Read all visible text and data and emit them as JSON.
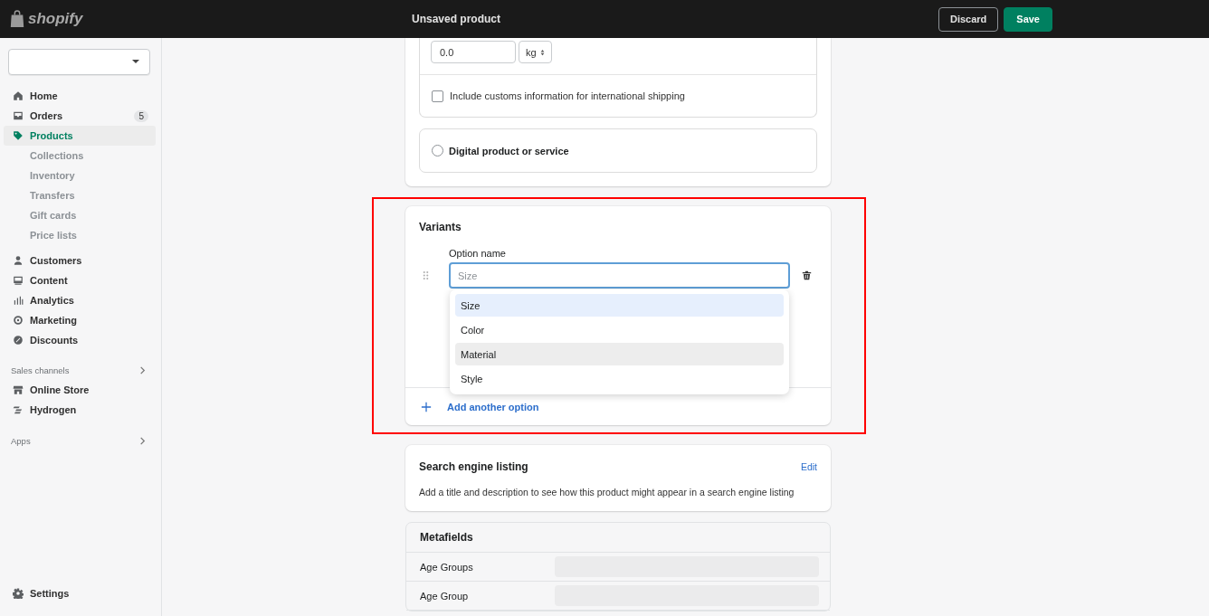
{
  "header": {
    "logo_text": "shopify",
    "title": "Unsaved product",
    "buttons": [
      {
        "label": "Discard",
        "kind": "secondary"
      },
      {
        "label": "Save",
        "kind": "primary"
      }
    ]
  },
  "sidebar": {
    "nav": [
      {
        "label": "Home",
        "selected": false
      },
      {
        "label": "Orders",
        "selected": false,
        "badge": "5"
      },
      {
        "label": "Products",
        "selected": true,
        "children": [
          {
            "label": "Collections",
            "selected": false
          },
          {
            "label": "Inventory",
            "selected": false
          },
          {
            "label": "Transfers",
            "selected": false
          },
          {
            "label": "Gift cards",
            "selected": false
          },
          {
            "label": "Price lists",
            "selected": false
          }
        ]
      },
      {
        "label": "Customers",
        "selected": false
      },
      {
        "label": "Content",
        "selected": false
      },
      {
        "label": "Analytics",
        "selected": false
      },
      {
        "label": "Marketing",
        "selected": false
      },
      {
        "label": "Discounts",
        "selected": false
      }
    ],
    "sales_channels": {
      "label": "Sales channels",
      "items": [
        {
          "label": "Online Store",
          "selected": false
        },
        {
          "label": "Hydrogen",
          "selected": false
        }
      ]
    },
    "apps": {
      "label": "Apps"
    },
    "settings": {
      "label": "Settings"
    }
  },
  "shipping": {
    "weight": "0.0",
    "unit": "kg",
    "customs": {
      "label": "Include customs information for international shipping",
      "checked": false
    },
    "digital": {
      "label": "Digital product or service",
      "selected": false
    }
  },
  "variants": {
    "title": "Variants",
    "option_label": "Option name",
    "placeholder": "Size",
    "suggestions": [
      {
        "label": "Size",
        "selected": true,
        "hovered": false
      },
      {
        "label": "Color",
        "selected": false,
        "hovered": false
      },
      {
        "label": "Material",
        "selected": false,
        "hovered": true
      },
      {
        "label": "Style",
        "selected": false,
        "hovered": false
      }
    ],
    "add_option": "Add another option"
  },
  "seo": {
    "title": "Search engine listing",
    "edit": "Edit",
    "description": "Add a title and description to see how this product might appear in a search engine listing"
  },
  "metafields": {
    "title": "Metafields",
    "rows": [
      {
        "label": "Age Groups"
      },
      {
        "label": "Age Group"
      }
    ]
  }
}
